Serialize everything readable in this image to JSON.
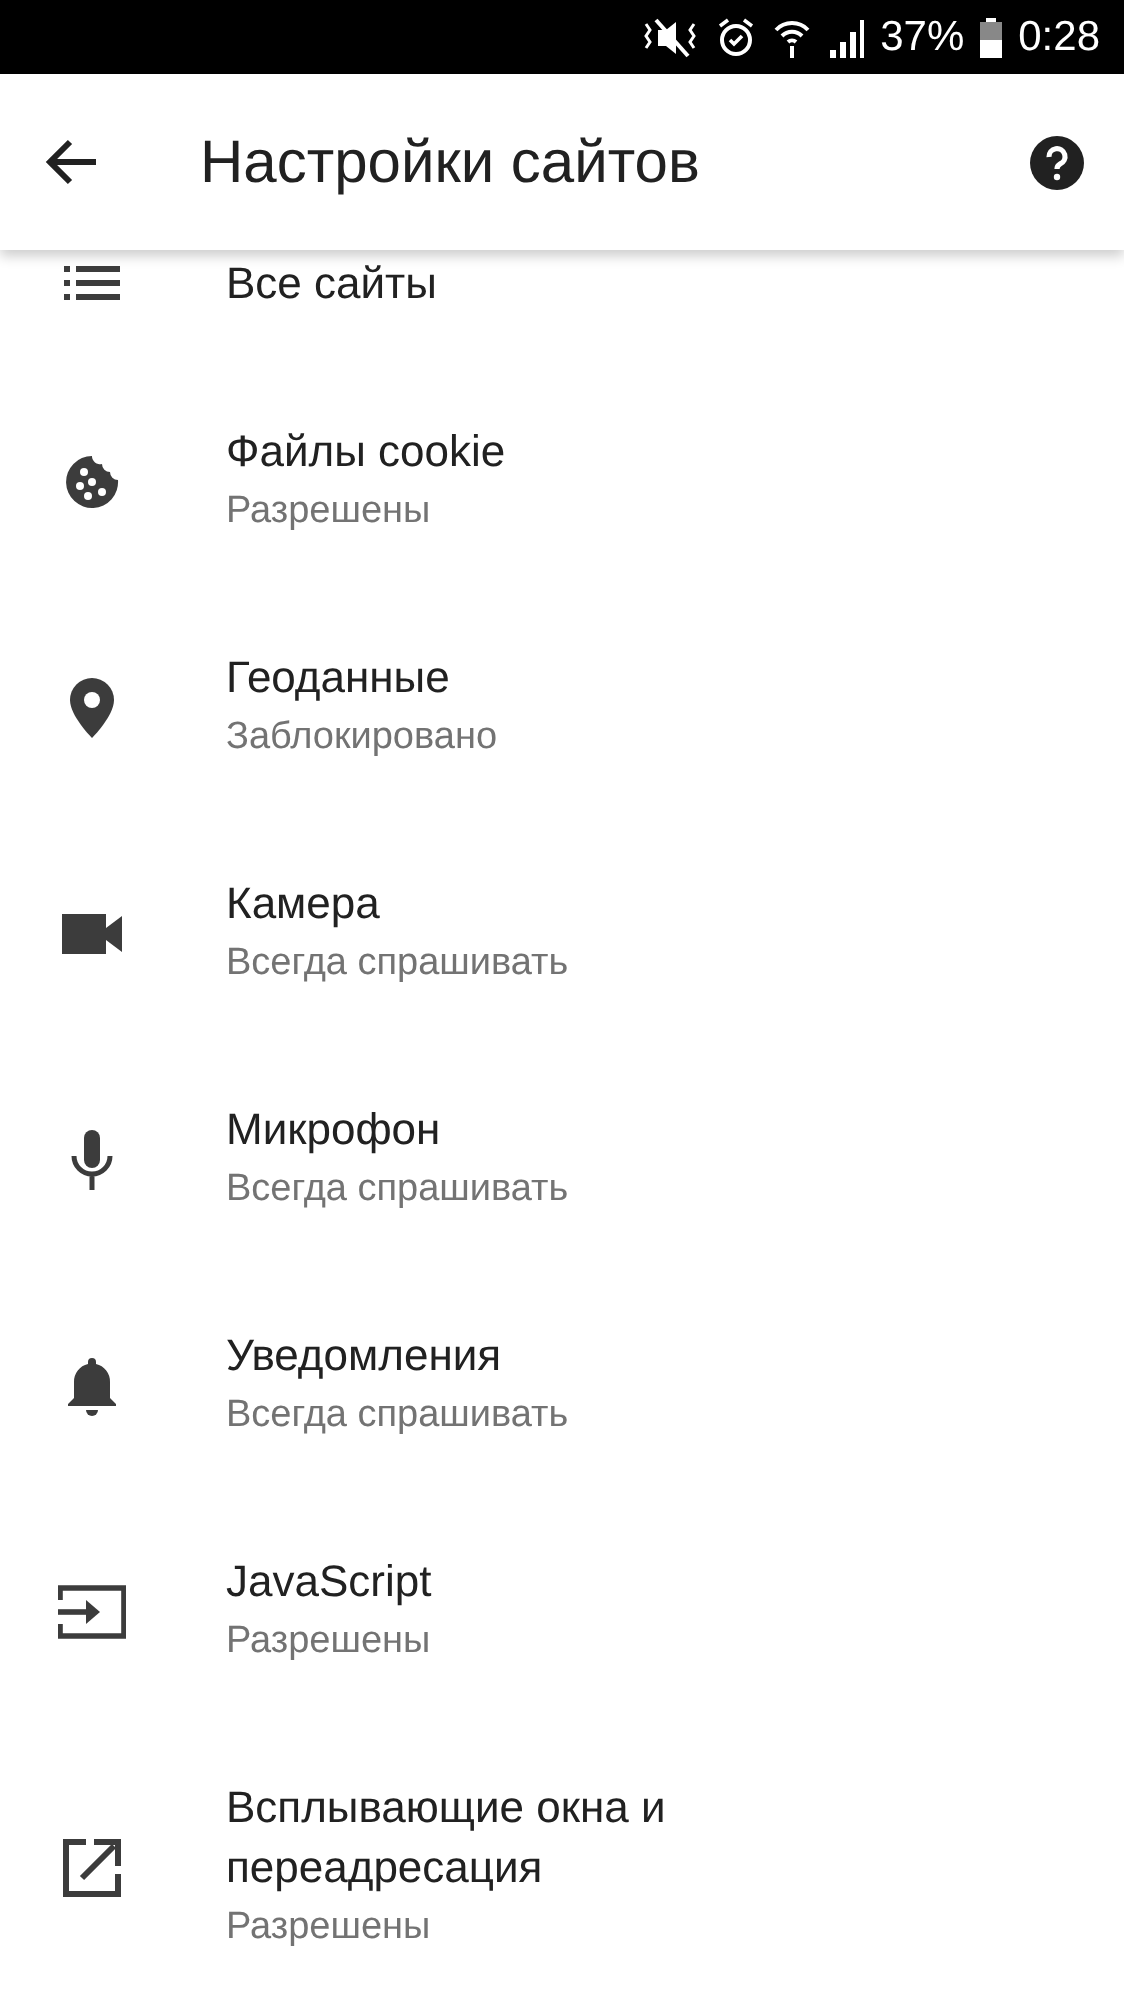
{
  "status_bar": {
    "battery": "37%",
    "time": "0:28"
  },
  "app_bar": {
    "title": "Настройки сайтов"
  },
  "items": [
    {
      "kind": "list",
      "title": "Все сайты"
    },
    {
      "kind": "cookie",
      "title": "Файлы cookie",
      "subtitle": "Разрешены"
    },
    {
      "kind": "location",
      "title": "Геоданные",
      "subtitle": "Заблокировано"
    },
    {
      "kind": "camera",
      "title": "Камера",
      "subtitle": "Всегда спрашивать"
    },
    {
      "kind": "mic",
      "title": "Микрофон",
      "subtitle": "Всегда спрашивать"
    },
    {
      "kind": "bell",
      "title": "Уведомления",
      "subtitle": "Всегда спрашивать"
    },
    {
      "kind": "input",
      "title": "JavaScript",
      "subtitle": "Разрешены"
    },
    {
      "kind": "open",
      "title": "Всплывающие окна и переадресация",
      "subtitle": "Разрешены"
    }
  ]
}
